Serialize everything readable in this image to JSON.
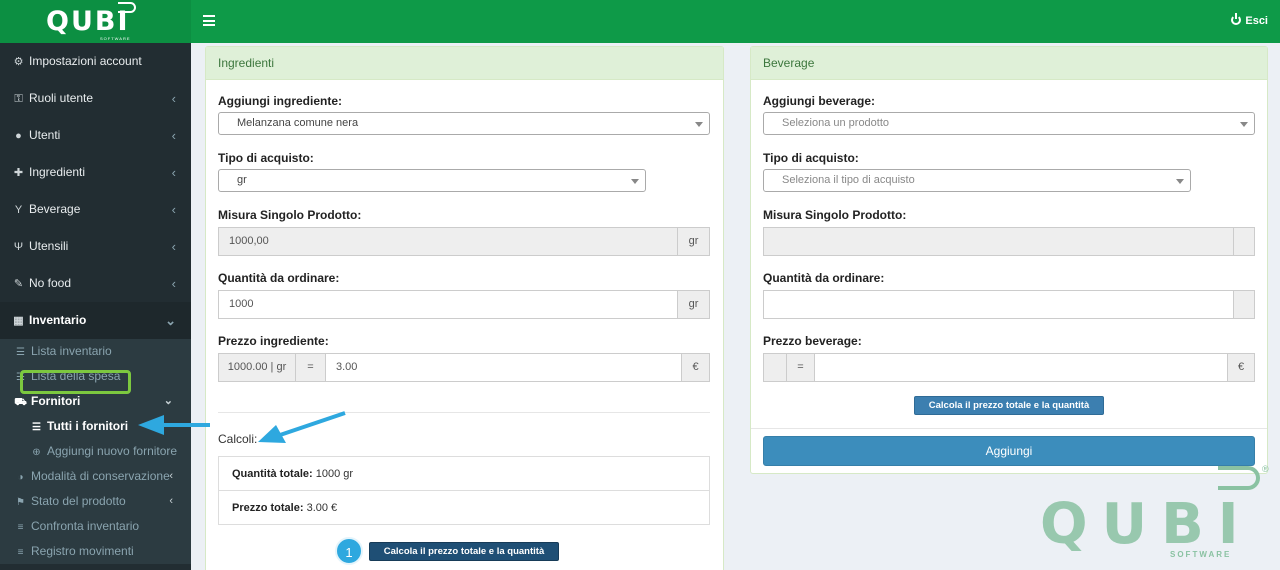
{
  "brand": {
    "name": "QUBI",
    "sub": "SOFTWARE",
    "reg": "®"
  },
  "topbar": {
    "logout": "Esci"
  },
  "sidebar": {
    "items": [
      {
        "icon": "⚙",
        "label": "Impostazioni account"
      },
      {
        "icon": "🔓",
        "label": "Ruoli utente",
        "chev": "‹"
      },
      {
        "icon": "👤",
        "label": "Utenti",
        "chev": "‹"
      },
      {
        "icon": "⛶",
        "label": "Ingredienti",
        "chev": "‹"
      },
      {
        "icon": "Y",
        "label": "Beverage",
        "chev": "‹"
      },
      {
        "icon": "Ψ",
        "label": "Utensili",
        "chev": "‹"
      },
      {
        "icon": "🔧",
        "label": "No food",
        "chev": "‹"
      },
      {
        "icon": "▦",
        "label": "Inventario",
        "chev": "⌄"
      }
    ],
    "inventario_sub": [
      {
        "icon": "☰",
        "label": "Lista inventario"
      },
      {
        "icon": "☷",
        "label": "Lista della spesa"
      },
      {
        "icon": "⛟",
        "label": "Fornitori",
        "chev": "⌄"
      }
    ],
    "fornitori_sub": [
      {
        "icon": "☰",
        "label": "Tutti i fornitori"
      },
      {
        "icon": "⊕",
        "label": "Aggiungi nuovo fornitore"
      }
    ],
    "inventario_more": [
      {
        "icon": "◑",
        "label": "Modalità di conservazione",
        "chev": "‹"
      },
      {
        "icon": "⚑",
        "label": "Stato del prodotto",
        "chev": "‹"
      },
      {
        "icon": "≡",
        "label": "Confronta inventario"
      },
      {
        "icon": "≡",
        "label": "Registro movimenti"
      }
    ]
  },
  "ingredienti": {
    "title": "Ingredienti",
    "add_label": "Aggiungi ingrediente:",
    "add_value": "Melanzana comune nera",
    "tipo_label": "Tipo di acquisto:",
    "tipo_value": "gr",
    "misura_label": "Misura Singolo Prodotto:",
    "misura_value": "1000,00",
    "misura_unit": "gr",
    "qty_label": "Quantità da ordinare:",
    "qty_value": "1000",
    "qty_unit": "gr",
    "prezzo_label": "Prezzo ingrediente:",
    "prezzo_base": "1000.00 | gr",
    "prezzo_eq": "=",
    "prezzo_value": "3.00",
    "prezzo_currency": "€",
    "calc_label": "Calcoli:",
    "qty_tot_label": "Quantità totale:",
    "qty_tot_value": "1000 gr",
    "price_tot_label": "Prezzo totale:",
    "price_tot_value": "3.00 €",
    "step": "1",
    "calc_button": "Calcola il prezzo totale e la quantità totale"
  },
  "beverage": {
    "title": "Beverage",
    "add_label": "Aggiungi beverage:",
    "add_placeholder": "Seleziona un prodotto",
    "tipo_label": "Tipo di acquisto:",
    "tipo_placeholder": "Seleziona il tipo di acquisto",
    "misura_label": "Misura Singolo Prodotto:",
    "qty_label": "Quantità da ordinare:",
    "prezzo_label": "Prezzo beverage:",
    "prezzo_eq": "=",
    "prezzo_currency": "€",
    "calc_button": "Calcola il prezzo totale e la quantità totale",
    "add_button": "Aggiungi"
  },
  "colors": {
    "topbar": "#0e9a48",
    "sidebar": "#222d32",
    "highlight": "#7cc83f",
    "arrow": "#2ea8df"
  }
}
